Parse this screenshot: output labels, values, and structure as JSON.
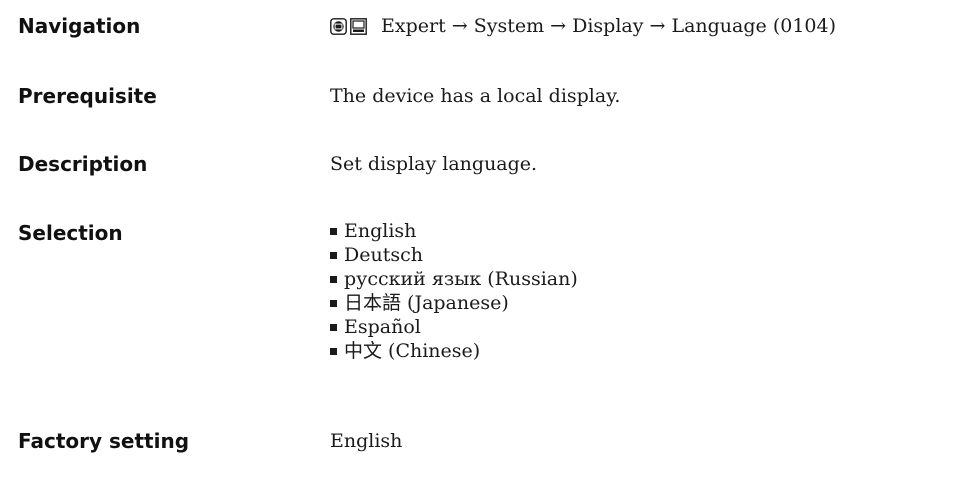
{
  "navigation": {
    "label": "Navigation",
    "icons": [
      "display-operation-icon",
      "display-list-icon"
    ],
    "path": "Expert → System → Display → Language (0104)"
  },
  "prerequisite": {
    "label": "Prerequisite",
    "value": "The device has a local display."
  },
  "description": {
    "label": "Description",
    "value": "Set display language."
  },
  "selection": {
    "label": "Selection",
    "options": [
      "English",
      "Deutsch",
      "русский язык (Russian)",
      "日本語 (Japanese)",
      "Español",
      "中文 (Chinese)"
    ]
  },
  "factory_setting": {
    "label": "Factory setting",
    "value": "English"
  }
}
